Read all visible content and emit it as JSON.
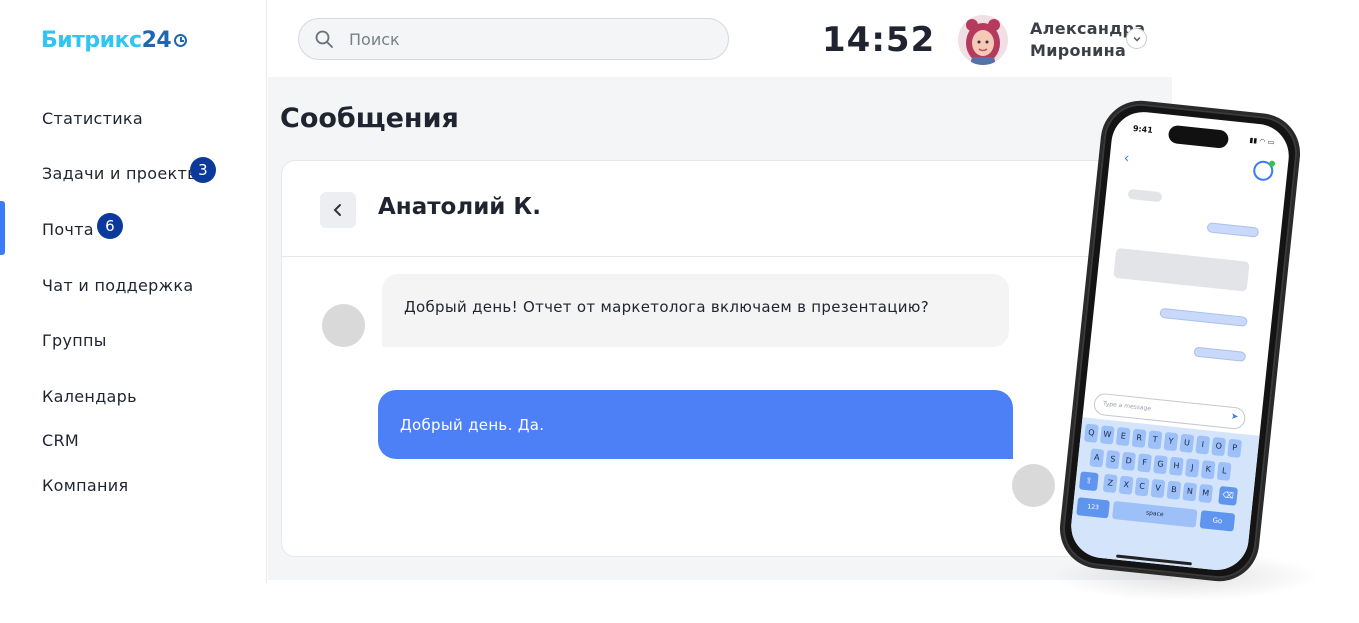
{
  "logo": {
    "brand": "Битрикс",
    "suffix": "24"
  },
  "sidebar": {
    "items": [
      {
        "label": "Статистика",
        "badge": ""
      },
      {
        "label": "Задачи и проекты",
        "badge": "3"
      },
      {
        "label": "Почта",
        "badge": "6"
      },
      {
        "label": "Чат и поддержка",
        "badge": ""
      },
      {
        "label": "Группы",
        "badge": ""
      },
      {
        "label": "Календарь",
        "badge": ""
      },
      {
        "label": "CRM",
        "badge": ""
      },
      {
        "label": "Компания",
        "badge": ""
      }
    ],
    "active_index": 2
  },
  "header": {
    "search_placeholder": "Поиск",
    "time": "14:52",
    "user_first": "Александра",
    "user_last": "Миронина"
  },
  "main": {
    "title": "Сообщения",
    "chat": {
      "contact": "Анатолий К.",
      "messages": [
        {
          "from": "contact",
          "text": "Добрый день! Отчет от маркетолога включаем в презентацию?"
        },
        {
          "from": "me",
          "text": "Добрый день. Да."
        }
      ]
    }
  },
  "phone": {
    "time": "9:41",
    "input_placeholder": "Type a message",
    "keyboard": {
      "row1": [
        "Q",
        "W",
        "E",
        "R",
        "T",
        "Y",
        "U",
        "I",
        "O",
        "P"
      ],
      "row2": [
        "A",
        "S",
        "D",
        "F",
        "G",
        "H",
        "J",
        "K",
        "L"
      ],
      "row3": [
        "Z",
        "X",
        "C",
        "V",
        "B",
        "N",
        "M"
      ],
      "num_key": "123",
      "space_key": "space",
      "go_key": "Go"
    }
  },
  "colors": {
    "accent": "#4d80f6",
    "badge": "#0b3a9c",
    "logo_light": "#2fc6f6",
    "logo_dark": "#2067b0"
  }
}
